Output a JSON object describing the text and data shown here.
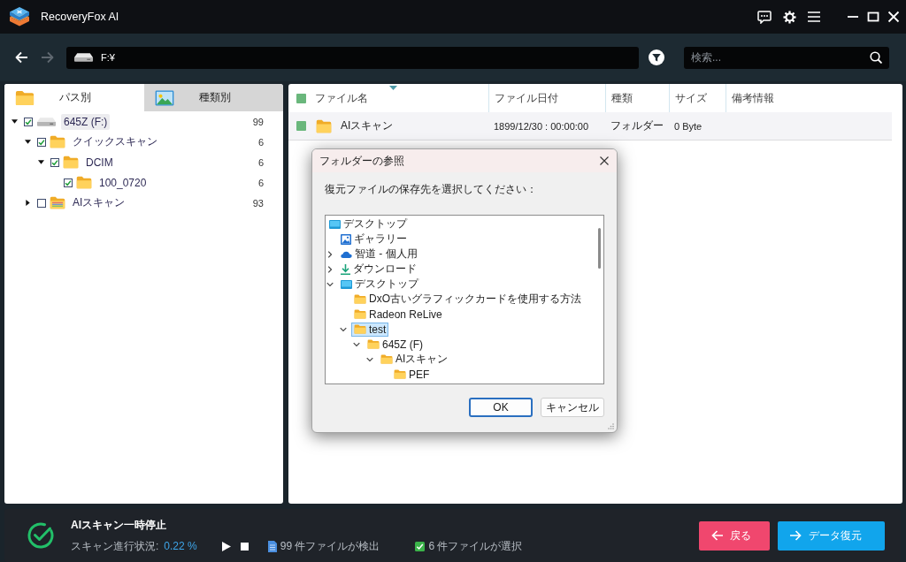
{
  "window": {
    "title": "RecoveryFox AI"
  },
  "toolbar": {
    "nav": [
      {
        "kind": "back",
        "disabled": false
      },
      {
        "kind": "forward",
        "disabled": true
      }
    ],
    "path": "F:¥",
    "search": {
      "placeholder": "検索..."
    }
  },
  "left_panel": {
    "tabs": [
      {
        "label": "パス別",
        "kind": "folder",
        "selected": true
      },
      {
        "label": "種類別",
        "kind": "image",
        "selected": false
      }
    ],
    "tree": [
      {
        "label": "645Z (F:)",
        "count": "99",
        "kind": "drive",
        "checked": true,
        "expanded": true,
        "selected": true,
        "children": [
          {
            "label": "クイックスキャン",
            "count": "6",
            "kind": "folder",
            "checked": true,
            "expanded": true,
            "selected": false,
            "children": [
              {
                "label": "DCIM",
                "count": "6",
                "kind": "folder",
                "checked": true,
                "expanded": true,
                "selected": false,
                "children": [
                  {
                    "label": "100_0720",
                    "count": "6",
                    "kind": "folder",
                    "checked": true,
                    "selected": false
                  }
                ]
              }
            ]
          },
          {
            "label": "AIスキャン",
            "count": "93",
            "kind": "scan-folder",
            "checked": false,
            "expanded": false,
            "selected": false
          }
        ]
      }
    ]
  },
  "table": {
    "checked": true,
    "columns": [
      {
        "label": "ファイル名",
        "sorted": true
      },
      {
        "label": "ファイル日付",
        "sorted": false
      },
      {
        "label": "種類",
        "sorted": false
      },
      {
        "label": "サイズ",
        "sorted": false
      },
      {
        "label": "備考情報",
        "sorted": false
      }
    ],
    "rows": [
      {
        "checked": true,
        "kind": "folder",
        "cells": [
          "AIスキャン",
          "1899/12/30 : 00:00:00",
          "フォルダー",
          "0 Byte"
        ]
      }
    ]
  },
  "dialog": {
    "title": "フォルダーの参照",
    "prompt": "復元ファイルの保存先を選択してください：",
    "tree": [
      {
        "label": "デスクトップ",
        "kind": "desktop",
        "selected": false,
        "children": [
          {
            "label": "ギャラリー",
            "kind": "gallery",
            "selected": false
          },
          {
            "label": "智道 - 個人用",
            "kind": "cloud",
            "selected": false,
            "expanded": false
          },
          {
            "label": "ダウンロード",
            "kind": "download",
            "selected": false,
            "expanded": false
          },
          {
            "label": "デスクトップ",
            "kind": "desktop",
            "selected": false,
            "expanded": true,
            "children": [
              {
                "label": "DxO古いグラフィックカードを使用する方法",
                "kind": "folder",
                "selected": false
              },
              {
                "label": "Radeon ReLive",
                "kind": "folder",
                "selected": false
              },
              {
                "label": "test",
                "kind": "folder",
                "selected": true,
                "expanded": true,
                "children": [
                  {
                    "label": "645Z (F)",
                    "kind": "folder",
                    "selected": false,
                    "expanded": true,
                    "children": [
                      {
                        "label": "AIスキャン",
                        "kind": "folder",
                        "selected": false,
                        "expanded": true,
                        "children": [
                          {
                            "label": "PEF",
                            "kind": "folder",
                            "selected": false
                          }
                        ]
                      }
                    ]
                  }
                ]
              }
            ]
          }
        ]
      }
    ],
    "buttons": [
      {
        "label": "OK",
        "default": true
      },
      {
        "label": "キャンセル",
        "default": false
      }
    ]
  },
  "status_bar": {
    "title": "AIスキャン一時停止",
    "progress_label": "スキャン進行状況:",
    "progress_value": "0.22 %",
    "detected_count": "99 件ファイルが検出",
    "selected_count": "6 件ファイルが選択",
    "buttons": [
      {
        "label": "戻る",
        "kind": "back"
      },
      {
        "label": "データ復元",
        "kind": "recover"
      }
    ]
  }
}
